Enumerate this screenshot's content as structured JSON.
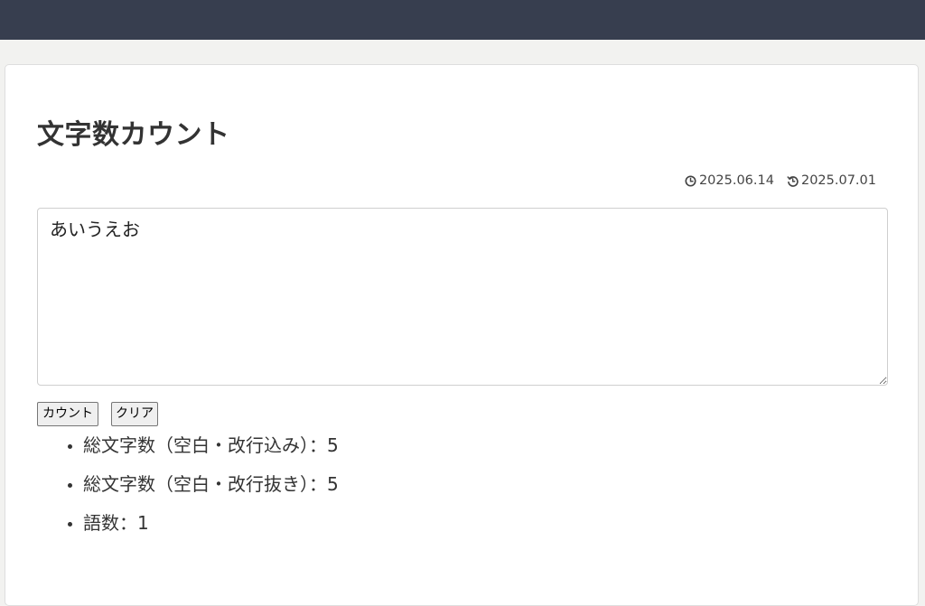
{
  "page": {
    "title": "文字数カウント",
    "published_date": "2025.06.14",
    "updated_date": "2025.07.01"
  },
  "editor": {
    "value": "あいうえお"
  },
  "buttons": {
    "count_label": "カウント",
    "clear_label": "クリア"
  },
  "results": [
    {
      "label": "総文字数（空白・改行込み）：",
      "value": "5"
    },
    {
      "label": "総文字数（空白・改行抜き）：",
      "value": "5"
    },
    {
      "label": "語数：",
      "value": "1"
    }
  ],
  "colors": {
    "topbar": "#373e4f",
    "background": "#f2f2f0",
    "card": "#ffffff",
    "text": "#333333"
  },
  "icons": {
    "published": "clock-icon",
    "updated": "history-icon"
  }
}
